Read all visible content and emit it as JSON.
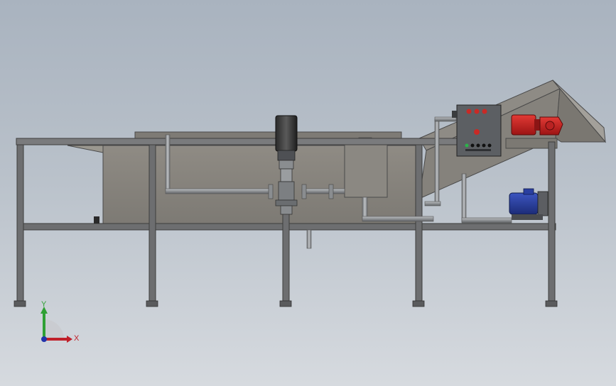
{
  "triad": {
    "x_label": "X",
    "y_label": "Y",
    "x_color": "#c0202a",
    "y_color": "#2fa034",
    "z_color": "#2233aa"
  },
  "colors": {
    "background_top": "#a9b3bf",
    "background_bottom": "#d6dadf",
    "steel_frame": "#6d6e70",
    "tank_body": "#8a8780",
    "motor_red": "#cc1f1f",
    "motor_blue": "#2a3fa0",
    "control_box": "#5c5f63"
  },
  "control_panel": {
    "lamps": [
      "red",
      "red",
      "red"
    ],
    "buttons": [
      "green",
      "black",
      "black",
      "black",
      "black"
    ]
  }
}
